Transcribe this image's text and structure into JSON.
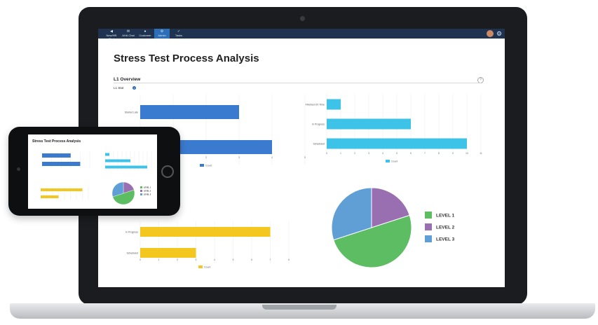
{
  "nav": {
    "items": [
      {
        "label": "New/HR Chat",
        "icon": "back-arrow-icon"
      },
      {
        "label": "AHA Chat",
        "icon": "chat-icon"
      },
      {
        "label": "Customer",
        "icon": "user-icon"
      },
      {
        "label": "Admin",
        "icon": "gear-icon"
      },
      {
        "label": "Tasks",
        "icon": "tasks-icon"
      }
    ],
    "active_index": 3
  },
  "page": {
    "title": "Stress Test Process Analysis",
    "section_title": "L1 Overview",
    "subsection_label": "L1 Stat",
    "help_glyph": "?",
    "info_glyph": "i"
  },
  "colors": {
    "navbar": "#1f3350",
    "nav_active": "#2c6fb8",
    "bar_blue": "#3a7bcf",
    "bar_cyan": "#3ec3e8",
    "bar_yellow": "#f3c620",
    "pie_level1": "#5cbd63",
    "pie_level2": "#9a6fb2",
    "pie_level3": "#5f9fd6"
  },
  "chart_data": [
    {
      "type": "bar",
      "orientation": "horizontal",
      "categories": [
        "Started Late",
        ""
      ],
      "values": [
        3,
        4
      ],
      "xlim": [
        0,
        5
      ],
      "legend": [
        "Count"
      ],
      "color": "#3a7bcf"
    },
    {
      "type": "bar",
      "orientation": "horizontal",
      "categories": [
        "Finished On Time",
        "In Progress",
        "Scheduled"
      ],
      "values": [
        1,
        6,
        10
      ],
      "xlim": [
        0,
        11
      ],
      "x_ticks": [
        "0",
        "1",
        "2",
        "3",
        "4",
        "5",
        "6",
        "7",
        "8",
        "9",
        "10",
        "11"
      ],
      "legend": [
        "Count"
      ],
      "color": "#3ec3e8"
    },
    {
      "type": "bar",
      "orientation": "horizontal",
      "categories": [
        "In Progress",
        "Scheduled"
      ],
      "values": [
        7,
        3
      ],
      "xlim": [
        0,
        8
      ],
      "x_ticks": [
        "0",
        "1",
        "2",
        "3",
        "4",
        "5",
        "6",
        "7",
        "8"
      ],
      "legend": [
        "Count"
      ],
      "color": "#f3c620"
    },
    {
      "type": "pie",
      "slices": [
        {
          "label": "LEVEL 1",
          "value": 50,
          "color": "#5cbd63"
        },
        {
          "label": "LEVEL 2",
          "value": 20,
          "color": "#9a6fb2"
        },
        {
          "label": "LEVEL 3",
          "value": 30,
          "color": "#5f9fd6"
        }
      ]
    }
  ],
  "phone": {
    "title": "Stress Test Process Analysis"
  }
}
